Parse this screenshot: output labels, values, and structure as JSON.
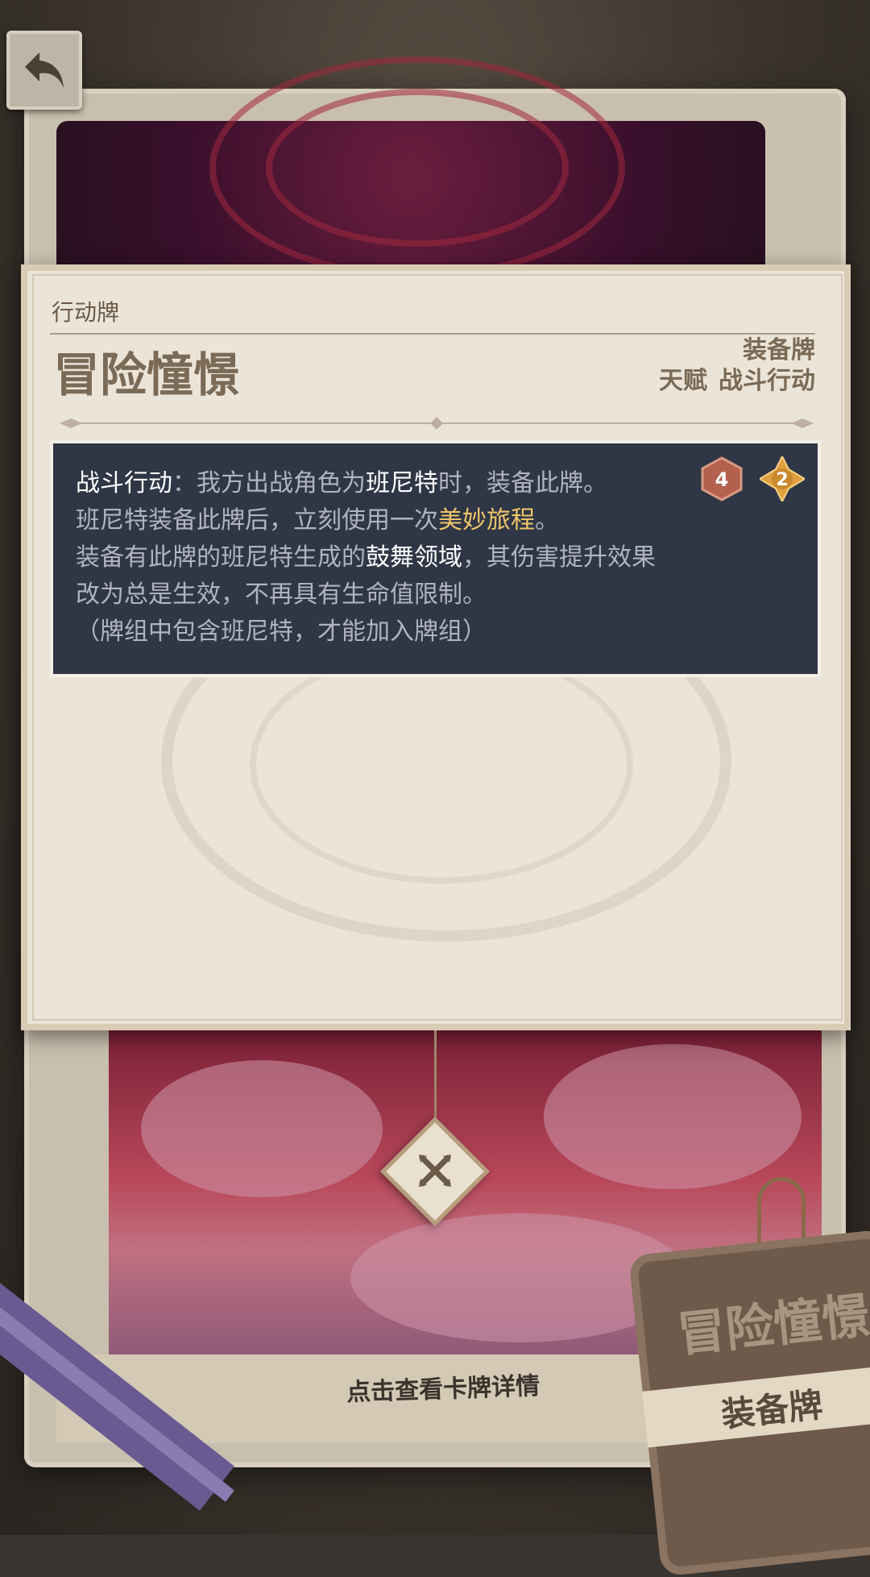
{
  "card": {
    "kind": "行动牌",
    "name": "冒险憧憬",
    "tags_line1": "装备牌",
    "tags_line2": [
      "天赋",
      "战斗行动"
    ],
    "costs": [
      {
        "value": "4",
        "type": "element-die"
      },
      {
        "value": "2",
        "type": "energy"
      }
    ],
    "description": {
      "line1": {
        "label": "战斗行动",
        "text_a": "：我方出战角色为",
        "character": "班尼特",
        "text_b": "时，装备此牌。"
      },
      "line2": {
        "text_a": "班尼特装备此牌后，立刻使用一次",
        "skill": "美妙旅程",
        "text_b": "。"
      },
      "line3": {
        "text_a": "装备有此牌的班尼特生成的",
        "field": "鼓舞领域",
        "text_b": "，其伤害提升效果"
      },
      "line4": "改为总是生效，不再具有生命值限制。",
      "line5": "（牌组中包含班尼特，才能加入牌组）"
    }
  },
  "background": {
    "caption": "点击查看卡牌详情",
    "tag_title": "冒险憧憬",
    "tag_subtitle": "装备牌"
  },
  "icons": {
    "back": "back-arrow-icon",
    "close": "close-x-icon"
  },
  "colors": {
    "description_bg": "#2f3746",
    "highlight_gold": "#f0c56a",
    "cost_die": "#b4604e",
    "cost_energy": "#e0a040",
    "title_brown": "#7a6a56"
  }
}
